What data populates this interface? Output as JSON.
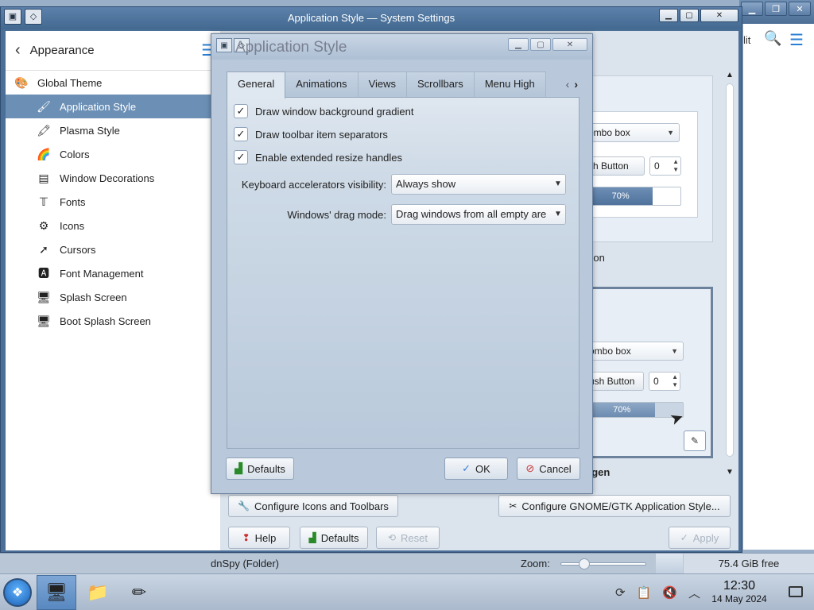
{
  "window": {
    "title": "Application Style — System Settings"
  },
  "background_window": {
    "partial_label": "lit"
  },
  "sidebar": {
    "header": "Appearance",
    "items": [
      {
        "label": "Global Theme",
        "icon": "global-theme-icon",
        "level": "top"
      },
      {
        "label": "Application Style",
        "icon": "application-style-icon",
        "level": "sub",
        "active": true
      },
      {
        "label": "Plasma Style",
        "icon": "plasma-style-icon",
        "level": "sub"
      },
      {
        "label": "Colors",
        "icon": "colors-icon",
        "level": "sub"
      },
      {
        "label": "Window Decorations",
        "icon": "window-decorations-icon",
        "level": "sub"
      },
      {
        "label": "Fonts",
        "icon": "fonts-icon",
        "level": "sub"
      },
      {
        "label": "Icons",
        "icon": "icons-icon",
        "level": "sub"
      },
      {
        "label": "Cursors",
        "icon": "cursors-icon",
        "level": "sub"
      },
      {
        "label": "Font Management",
        "icon": "font-management-icon",
        "level": "sub"
      },
      {
        "label": "Splash Screen",
        "icon": "splash-screen-icon",
        "level": "sub"
      },
      {
        "label": "Boot Splash Screen",
        "icon": "boot-splash-screen-icon",
        "level": "sub"
      }
    ]
  },
  "preview": {
    "combo_label": "ombo box",
    "push_label": "sh Button",
    "push_label_2": "ush Button",
    "spin_value": "0",
    "progress_text": "70%",
    "progress_value": 0.7,
    "partial_text": "sion",
    "style_name": "ygen"
  },
  "bottom": {
    "configure_icons": "Configure Icons and Toolbars",
    "configure_gtk": "Configure GNOME/GTK Application Style...",
    "help": "Help",
    "defaults": "Defaults",
    "reset": "Reset",
    "apply": "Apply"
  },
  "dialog": {
    "title": "Application Style",
    "tabs": [
      "General",
      "Animations",
      "Views",
      "Scrollbars",
      "Menu High"
    ],
    "active_tab": "General",
    "checkboxes": [
      {
        "label": "Draw window background gradient",
        "checked": true
      },
      {
        "label": "Draw toolbar item separators",
        "checked": true
      },
      {
        "label": "Enable extended resize handles",
        "checked": true
      }
    ],
    "keyboard_label": "Keyboard accelerators visibility:",
    "keyboard_value": "Always show",
    "drag_label": "Windows' drag mode:",
    "drag_value": "Drag windows from all empty are",
    "defaults_btn": "Defaults",
    "ok_btn": "OK",
    "cancel_btn": "Cancel"
  },
  "statusbar": {
    "dnspy": "dnSpy (Folder)",
    "zoom_label": "Zoom:",
    "free": "75.4 GiB free"
  },
  "clock": {
    "time": "12:30",
    "date": "14 May 2024"
  }
}
